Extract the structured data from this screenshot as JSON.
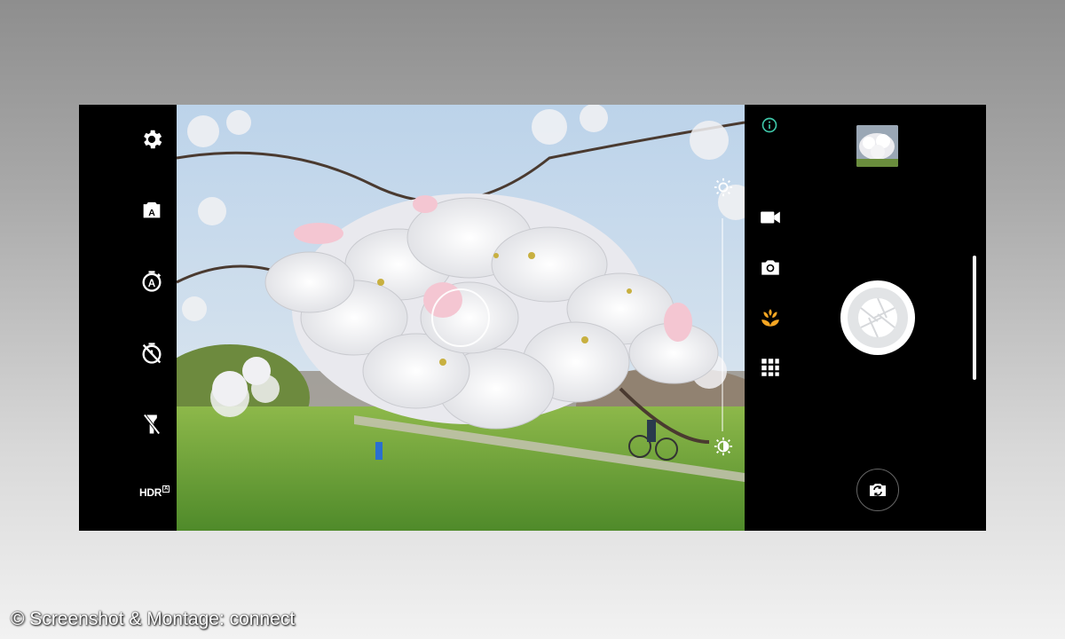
{
  "left_toolbar": {
    "items": [
      {
        "icon": "settings-gear-icon",
        "name": "settings-button"
      },
      {
        "icon": "auto-scene-icon",
        "name": "scene-mode-button"
      },
      {
        "icon": "auto-timer-icon",
        "name": "auto-capture-button"
      },
      {
        "icon": "timer-off-icon",
        "name": "self-timer-button"
      },
      {
        "icon": "flash-off-icon",
        "name": "flash-button"
      }
    ],
    "hdr_label": "HDR",
    "hdr_badge": "A"
  },
  "viewfinder": {
    "exposure_icon_top": "brightness-high-icon",
    "exposure_icon_bottom": "brightness-low-icon"
  },
  "right_panel": {
    "info_icon": "info-icon",
    "modes": [
      {
        "icon": "video-camera-icon",
        "active": false
      },
      {
        "icon": "photo-camera-icon",
        "active": false
      },
      {
        "icon": "macro-flower-icon",
        "active": true
      },
      {
        "icon": "more-modes-grid-icon",
        "active": false
      }
    ],
    "shutter_icon": "shutter-aperture-icon",
    "switch_camera_icon": "switch-camera-icon"
  },
  "colors": {
    "accent_active": "#f5a623",
    "info": "#3ec6a8",
    "panel_bg": "#000000"
  },
  "credit_text": "© Screenshot & Montage: connect"
}
